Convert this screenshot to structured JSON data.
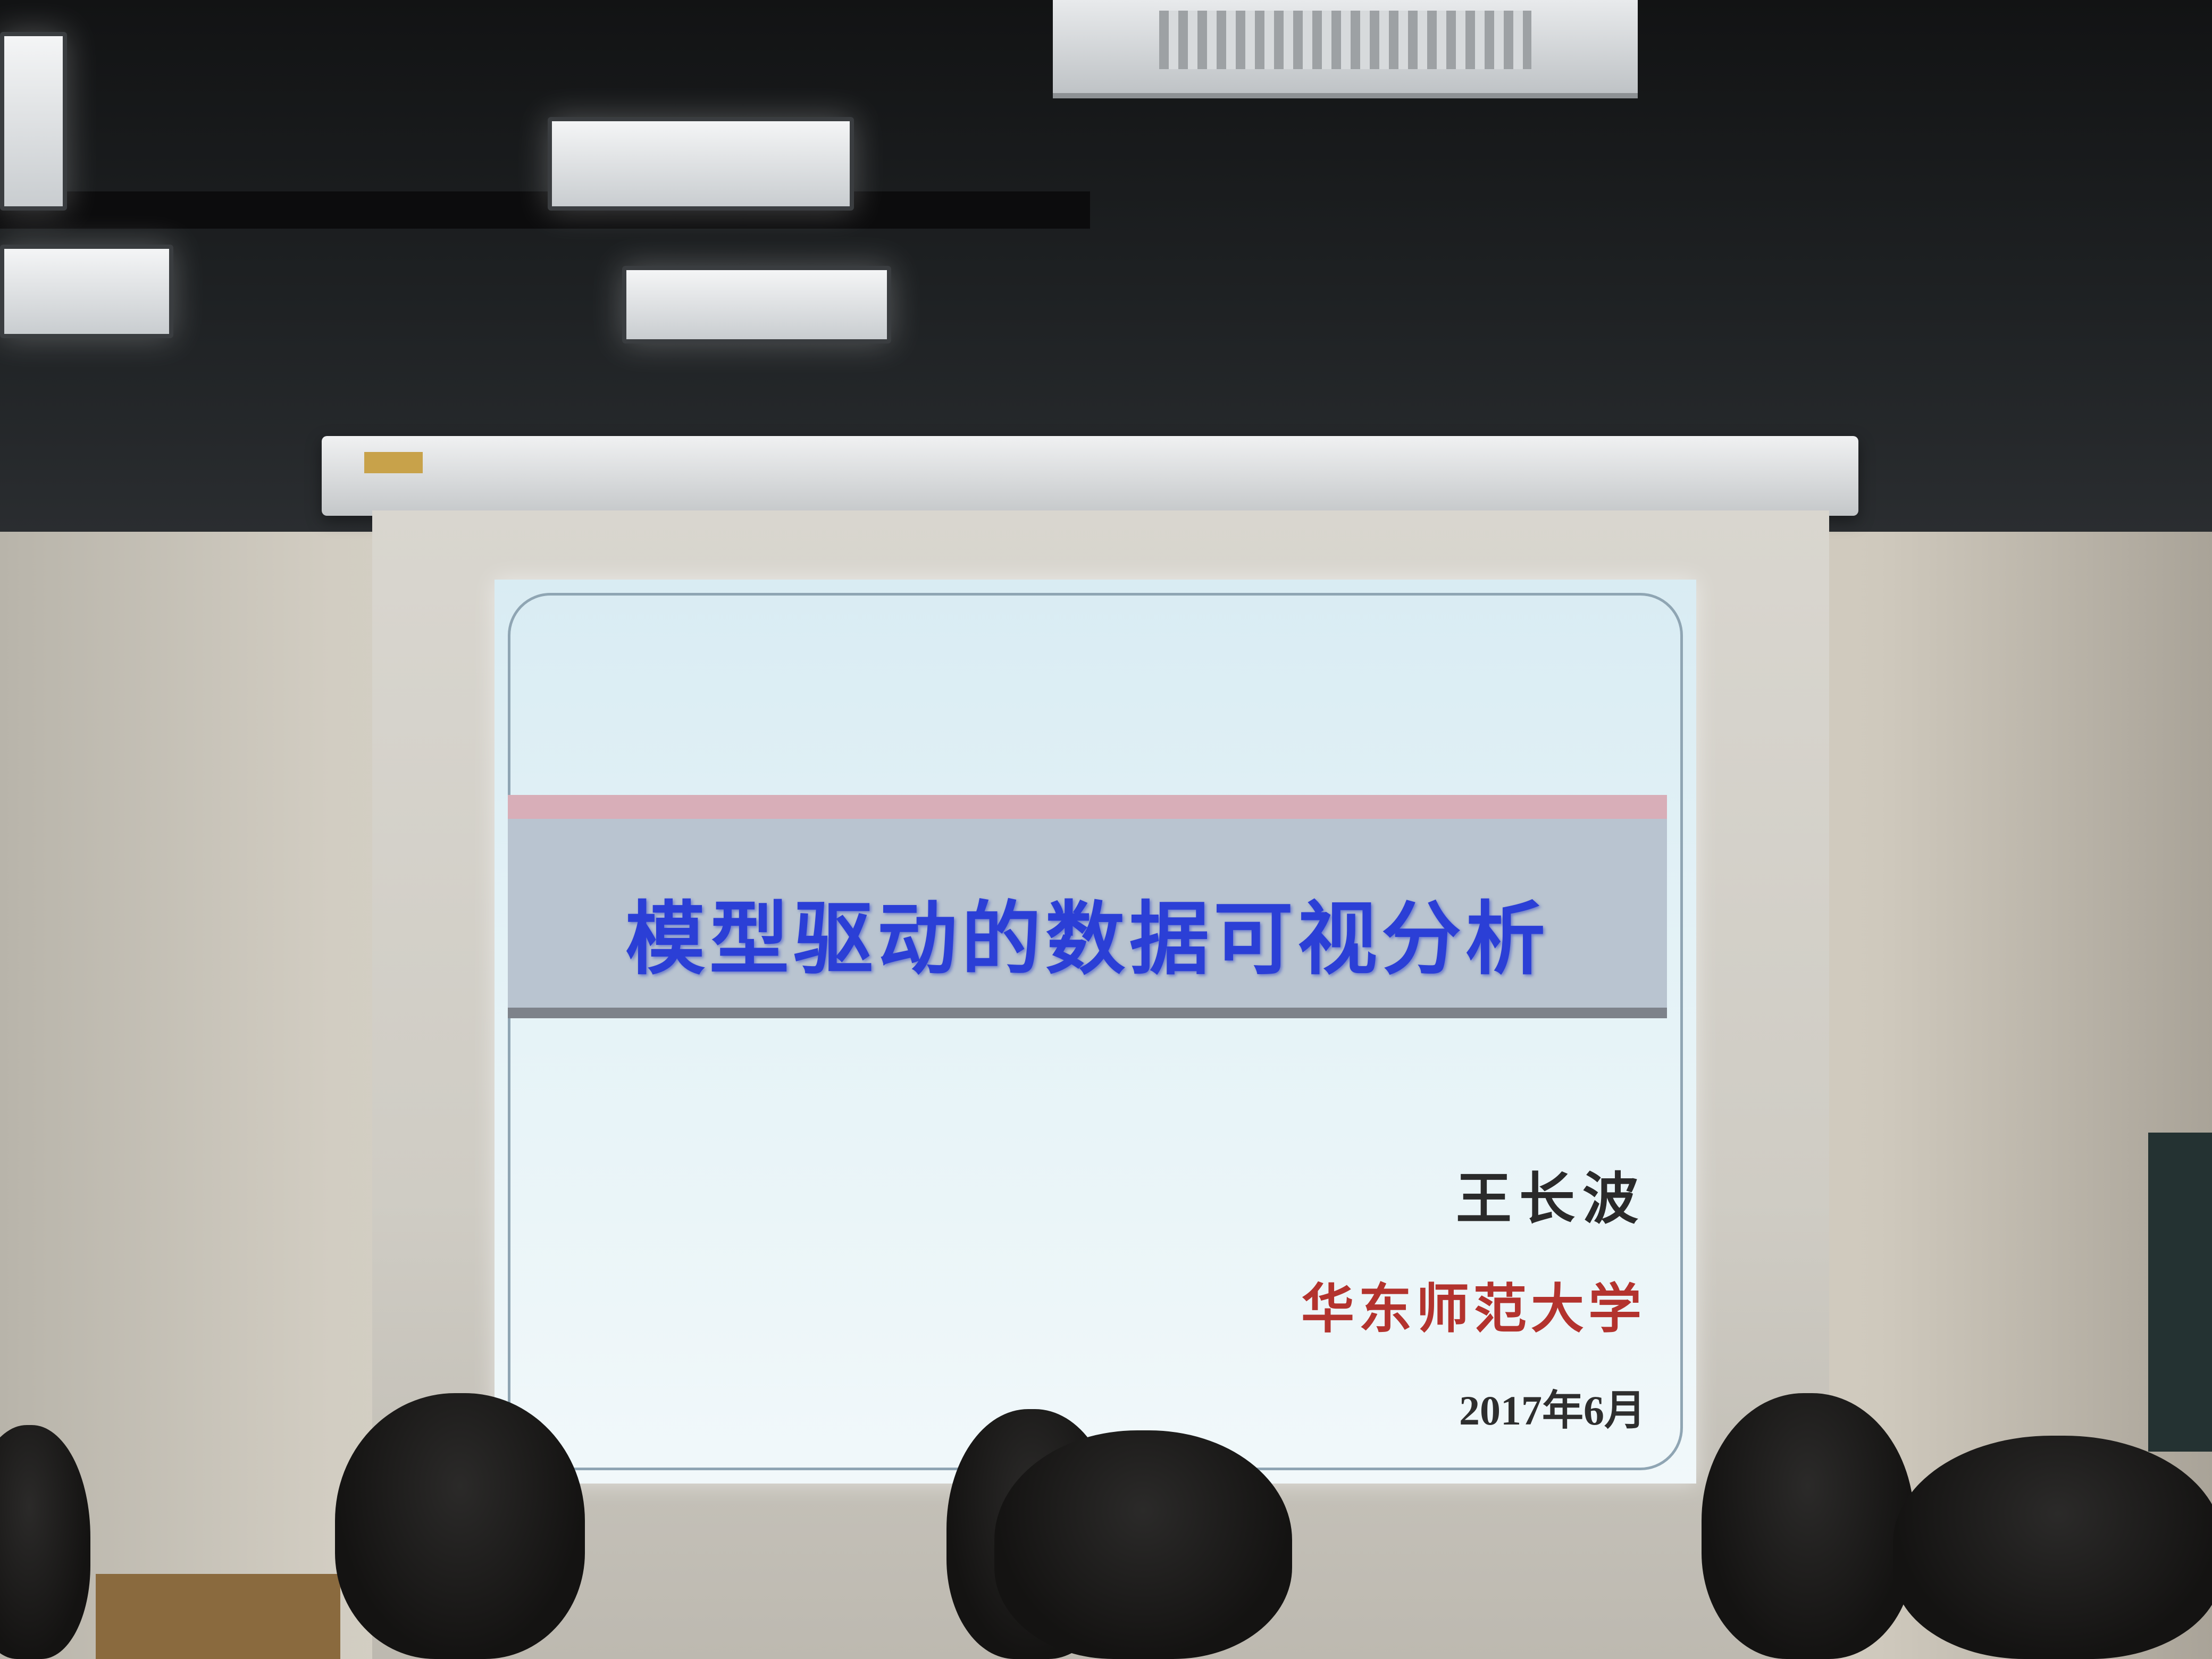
{
  "slide": {
    "title": "模型驱动的数据可视分析",
    "author": "王长波",
    "affiliation": "华东师范大学",
    "date": "2017年6月"
  },
  "colors": {
    "title": "#2b3fd6",
    "affiliation": "#b3332e",
    "slide_background": "#e6f3f7",
    "band": "#b9c4d0"
  }
}
